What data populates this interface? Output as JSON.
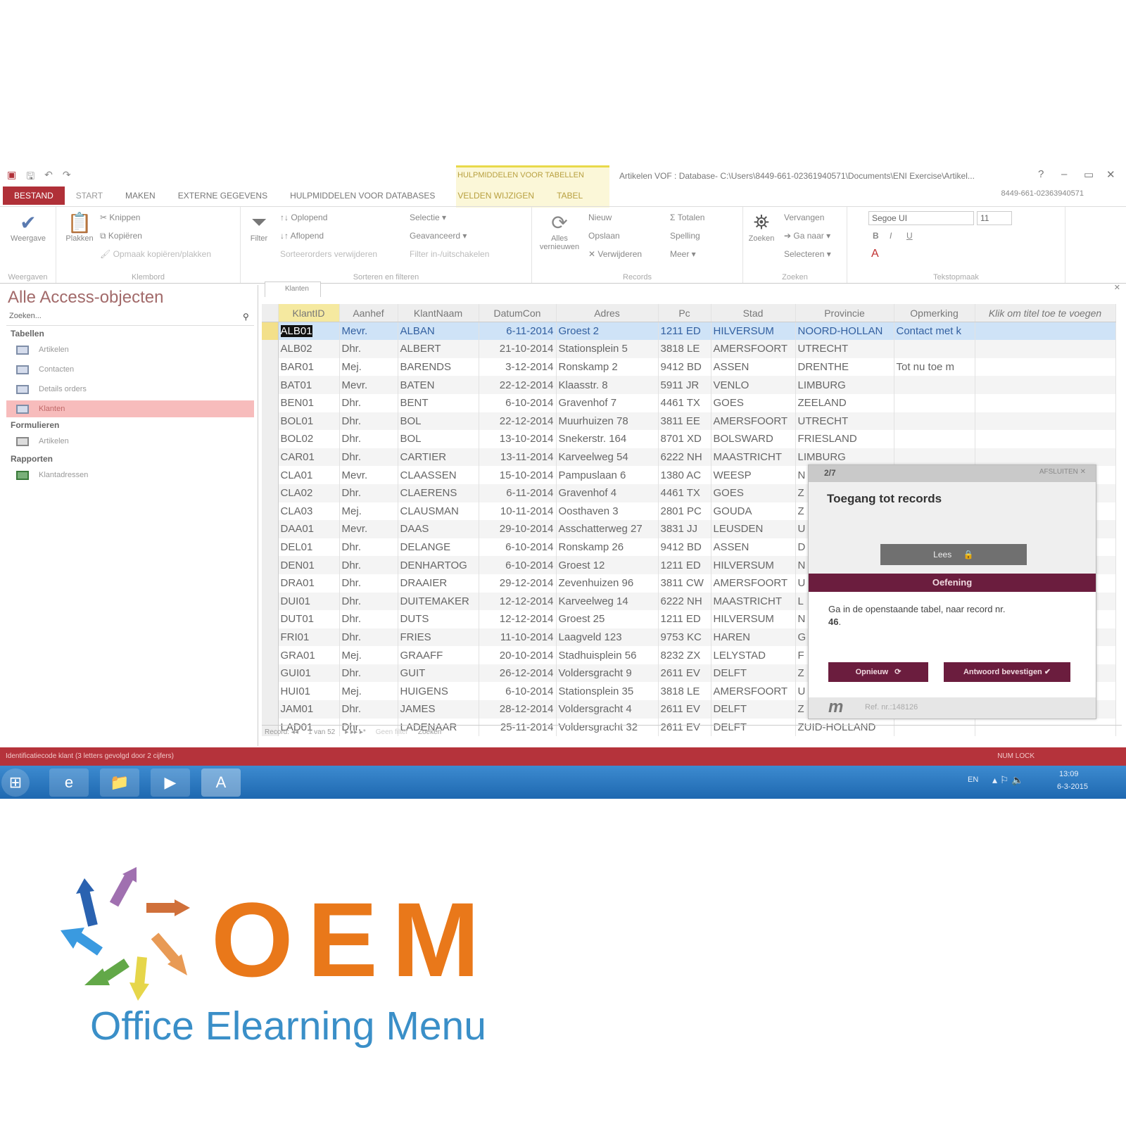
{
  "window": {
    "title": "Artikelen VOF : Database- C:\\Users\\8449-661-02361940571\\Documents\\ENI Exercise\\Artikel...",
    "contextual_group": "HULPMIDDELEN VOOR TABELLEN",
    "user": "8449-661-02363940571",
    "help": "?",
    "minimize": "–",
    "restore": "▭",
    "close": "✕"
  },
  "tabs": [
    "BESTAND",
    "START",
    "MAKEN",
    "EXTERNE GEGEVENS",
    "HULPMIDDELEN VOOR DATABASES",
    "VELDEN WIJZIGEN",
    "TABEL"
  ],
  "ribbon": {
    "weergave": {
      "button": "Weergave",
      "label": "Weergaven"
    },
    "klembord": {
      "plakken": "Plakken",
      "knippen": "Knippen",
      "kopieren": "Kopiëren",
      "opmaak": "Opmaak kopiëren/plakken",
      "label": "Klembord"
    },
    "sorteren": {
      "filter": "Filter",
      "oplopend": "Oplopend",
      "aflopend": "Aflopend",
      "verwijderen": "Sorteerorders verwijderen",
      "selectie": "Selectie ▾",
      "geavanceerd": "Geavanceerd ▾",
      "filter_toggle": "Filter in-/uitschakelen",
      "label": "Sorteren en filteren"
    },
    "records": {
      "alles": "Alles vernieuwen",
      "nieuw": "Nieuw",
      "opslaan": "Opslaan",
      "verwijderen": "Verwijderen",
      "totalen": "Totalen",
      "spelling": "Spelling",
      "meer": "Meer ▾",
      "label": "Records"
    },
    "zoeken": {
      "zoeken": "Zoeken",
      "vervangen": "Vervangen",
      "ga_naar": "Ga naar ▾",
      "selecteren": "Selecteren ▾",
      "label": "Zoeken"
    },
    "tekst": {
      "font": "Segoe UI",
      "size": "11",
      "bold": "B",
      "italic": "I",
      "underline": "U",
      "label": "Tekstopmaak"
    }
  },
  "nav": {
    "title": "Alle Access-objecten",
    "search_placeholder": "Zoeken...",
    "sections": [
      {
        "label": "Tabellen",
        "items": [
          "Artikelen",
          "Contacten",
          "Details orders",
          "Klanten"
        ]
      },
      {
        "label": "Formulieren",
        "items": [
          "Artikelen"
        ]
      },
      {
        "label": "Rapporten",
        "items": [
          "Klantadressen"
        ]
      }
    ],
    "selected": "Klanten"
  },
  "table": {
    "tab": "Klanten",
    "columns": [
      "KlantID",
      "Aanhef",
      "KlantNaam",
      "DatumCon",
      "Adres",
      "Pc",
      "Stad",
      "Provincie",
      "Opmerking",
      "Klik om titel toe te voegen"
    ],
    "rows": [
      [
        "ALB01",
        "Mevr.",
        "ALBAN",
        "6-11-2014",
        "Groest 2",
        "1211 ED",
        "HILVERSUM",
        "NOORD-HOLLAN",
        "Contact met k"
      ],
      [
        "ALB02",
        "Dhr.",
        "ALBERT",
        "21-10-2014",
        "Stationsplein 5",
        "3818 LE",
        "AMERSFOORT",
        "UTRECHT",
        ""
      ],
      [
        "BAR01",
        "Mej.",
        "BARENDS",
        "3-12-2014",
        "Ronskamp 2",
        "9412 BD",
        "ASSEN",
        "DRENTHE",
        "Tot nu toe m"
      ],
      [
        "BAT01",
        "Mevr.",
        "BATEN",
        "22-12-2014",
        "Klaasstr. 8",
        "5911 JR",
        "VENLO",
        "LIMBURG",
        ""
      ],
      [
        "BEN01",
        "Dhr.",
        "BENT",
        "6-10-2014",
        "Gravenhof 7",
        "4461 TX",
        "GOES",
        "ZEELAND",
        ""
      ],
      [
        "BOL01",
        "Dhr.",
        "BOL",
        "22-12-2014",
        "Muurhuizen 78",
        "3811 EE",
        "AMERSFOORT",
        "UTRECHT",
        ""
      ],
      [
        "BOL02",
        "Dhr.",
        "BOL",
        "13-10-2014",
        "Snekerstr. 164",
        "8701 XD",
        "BOLSWARD",
        "FRIESLAND",
        ""
      ],
      [
        "CAR01",
        "Dhr.",
        "CARTIER",
        "13-11-2014",
        "Karveelweg 54",
        "6222 NH",
        "MAASTRICHT",
        "LIMBURG",
        ""
      ],
      [
        "CLA01",
        "Mevr.",
        "CLAASSEN",
        "15-10-2014",
        "Pampuslaan 6",
        "1380 AC",
        "WEESP",
        "N",
        ""
      ],
      [
        "CLA02",
        "Dhr.",
        "CLAERENS",
        "6-11-2014",
        "Gravenhof 4",
        "4461 TX",
        "GOES",
        "Z",
        ""
      ],
      [
        "CLA03",
        "Mej.",
        "CLAUSMAN",
        "10-11-2014",
        "Oosthaven 3",
        "2801 PC",
        "GOUDA",
        "Z",
        ""
      ],
      [
        "DAA01",
        "Mevr.",
        "DAAS",
        "29-10-2014",
        "Asschatterweg 27",
        "3831 JJ",
        "LEUSDEN",
        "U",
        ""
      ],
      [
        "DEL01",
        "Dhr.",
        "DELANGE",
        "6-10-2014",
        "Ronskamp 26",
        "9412 BD",
        "ASSEN",
        "D",
        ""
      ],
      [
        "DEN01",
        "Dhr.",
        "DENHARTOG",
        "6-10-2014",
        "Groest 12",
        "1211 ED",
        "HILVERSUM",
        "N",
        ""
      ],
      [
        "DRA01",
        "Dhr.",
        "DRAAIER",
        "29-12-2014",
        "Zevenhuizen 96",
        "3811 CW",
        "AMERSFOORT",
        "U",
        ""
      ],
      [
        "DUI01",
        "Dhr.",
        "DUITEMAKER",
        "12-12-2014",
        "Karveelweg 14",
        "6222 NH",
        "MAASTRICHT",
        "L",
        ""
      ],
      [
        "DUT01",
        "Dhr.",
        "DUTS",
        "12-12-2014",
        "Groest 25",
        "1211 ED",
        "HILVERSUM",
        "N",
        ""
      ],
      [
        "FRI01",
        "Dhr.",
        "FRIES",
        "11-10-2014",
        "Laagveld 123",
        "9753 KC",
        "HAREN",
        "G",
        ""
      ],
      [
        "GRA01",
        "Mej.",
        "GRAAFF",
        "20-10-2014",
        "Stadhuisplein 56",
        "8232 ZX",
        "LELYSTAD",
        "F",
        ""
      ],
      [
        "GUI01",
        "Dhr.",
        "GUIT",
        "26-12-2014",
        "Voldersgracht 9",
        "2611 EV",
        "DELFT",
        "Z",
        ""
      ],
      [
        "HUI01",
        "Mej.",
        "HUIGENS",
        "6-10-2014",
        "Stationsplein 35",
        "3818 LE",
        "AMERSFOORT",
        "U",
        ""
      ],
      [
        "JAM01",
        "Dhr.",
        "JAMES",
        "28-12-2014",
        "Voldersgracht 4",
        "2611 EV",
        "DELFT",
        "Z",
        ""
      ],
      [
        "LAD01",
        "Dhr.",
        "LADENAAR",
        "25-11-2014",
        "Voldersgracht 32",
        "2611 EV",
        "DELFT",
        "ZUID-HOLLAND",
        ""
      ]
    ],
    "record_nav": {
      "label": "Record: ◂◂",
      "position": "1 van 52",
      "filter": "Geen filter",
      "search": "Zoeken"
    }
  },
  "status": {
    "text": "Identificatiecode klant (3 letters gevolgd door 2 cijfers)",
    "numlock": "NUM LOCK"
  },
  "taskbar": {
    "lang": "EN",
    "time": "13:09",
    "date": "6-3-2015"
  },
  "popup": {
    "step": "2/7",
    "close": "AFSLUITEN ✕",
    "title": "Toegang tot records",
    "lees": "Lees",
    "band": "Oefening",
    "text": "Ga in de openstaande tabel, naar record nr.",
    "number": "46",
    "opnieuw": "Opnieuw",
    "bevestigen": "Antwoord bevestigen",
    "ref": "Ref. nr.:148126"
  },
  "logo": {
    "text": "OEM",
    "subtitle": "Office Elearning Menu",
    "accent": "#e9781a",
    "subtitle_color": "#3a8fc8"
  }
}
